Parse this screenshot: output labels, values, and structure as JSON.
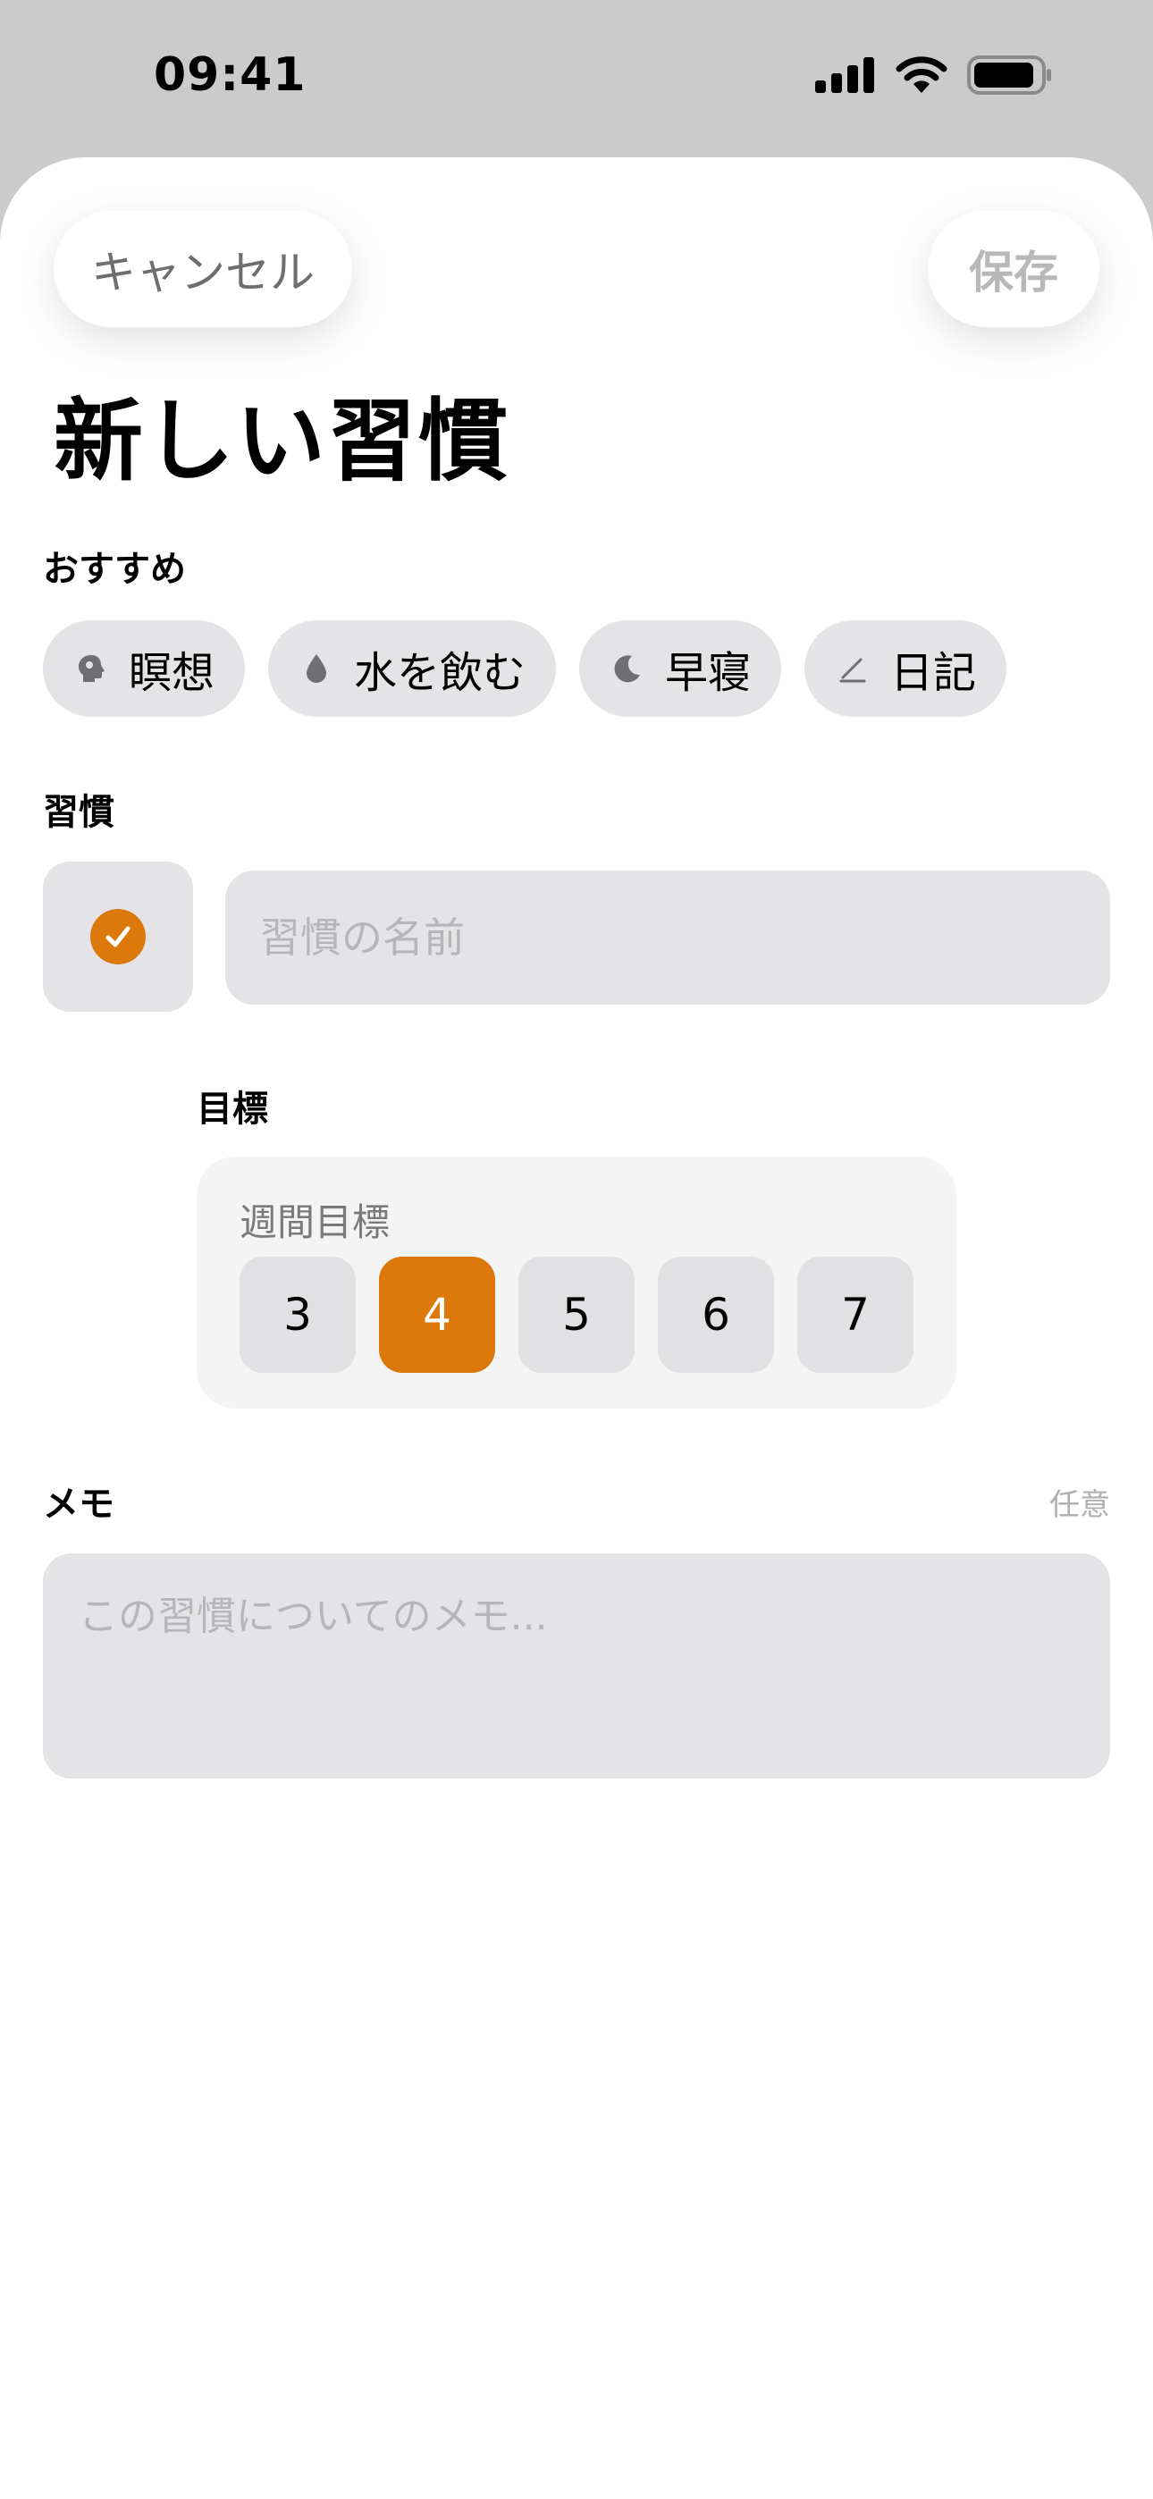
{
  "status_bar": {
    "time": "09:41",
    "icons": [
      "signal-icon",
      "wifi-icon",
      "battery-icon"
    ]
  },
  "header": {
    "cancel_label": "キャンセル",
    "save_label": "保存",
    "title": "新しい習慣"
  },
  "suggestions": {
    "label": "おすすめ",
    "items": [
      {
        "label": "瞑想",
        "icon": "brain-icon"
      },
      {
        "label": "水を飲む",
        "icon": "drop-icon"
      },
      {
        "label": "早寝",
        "icon": "moon-icon"
      },
      {
        "label": "日記",
        "icon": "pencil-icon"
      }
    ]
  },
  "habit": {
    "label": "習慣",
    "icon": "checkmark-circle-icon",
    "name_placeholder": "習慣の名前",
    "name_value": ""
  },
  "goal": {
    "label": "目標",
    "sublabel": "週間目標",
    "options": [
      "3",
      "4",
      "5",
      "6",
      "7"
    ],
    "selected": "4"
  },
  "memo": {
    "label": "メモ",
    "optional_label": "任意",
    "placeholder": "この習慣についてのメモ..."
  },
  "colors": {
    "accent": "#dd790b",
    "field_bg": "#e4e4e6",
    "background": "#cbcbcb"
  }
}
